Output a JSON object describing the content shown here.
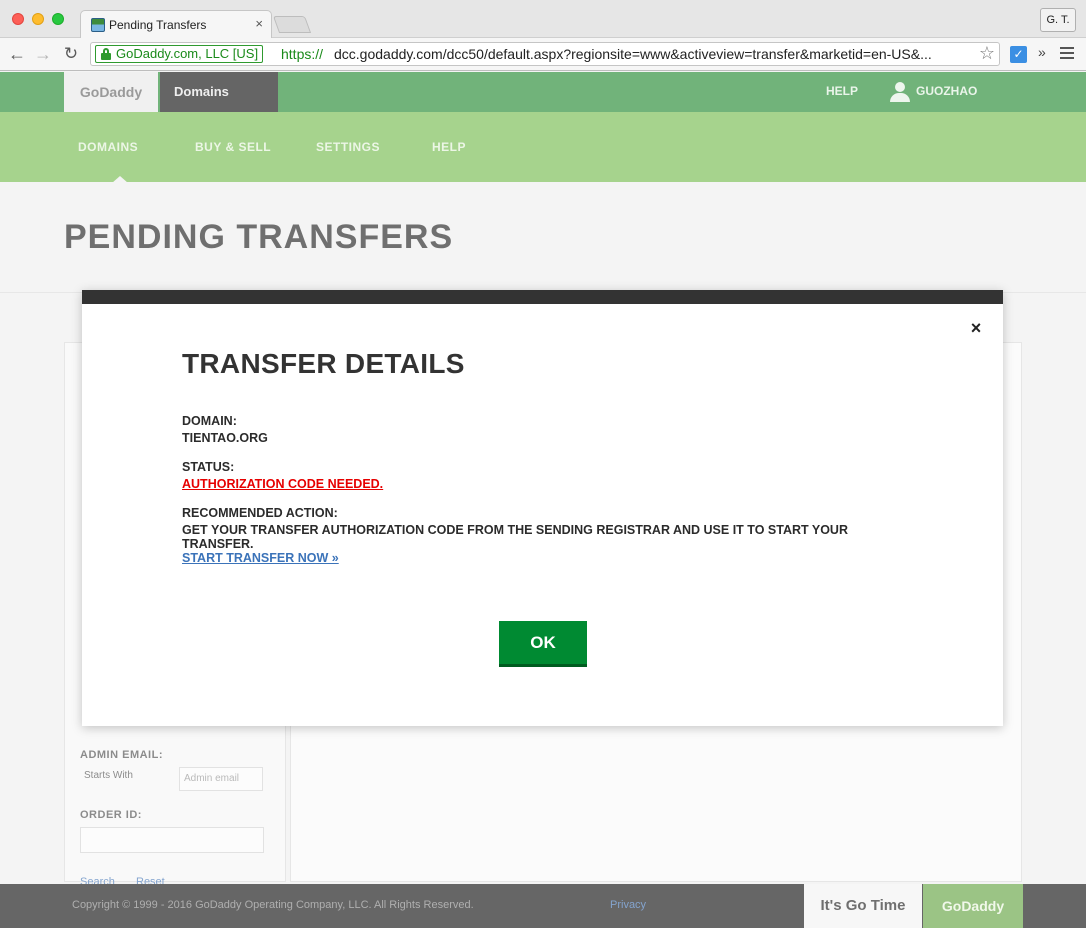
{
  "browser": {
    "tab_title": "Pending Transfers",
    "user_badge": "G. T.",
    "ev_label": "GoDaddy.com, LLC [US]",
    "url_scheme": "https://",
    "url_rest": "dcc.godaddy.com/dcc50/default.aspx?regionsite=www&activeview=transfer&marketid=en-US&..."
  },
  "site": {
    "logo": "GoDaddy",
    "product_switcher": "Domains",
    "help": "HELP",
    "username": "GUOZHAO",
    "nav": [
      "DOMAINS",
      "BUY & SELL",
      "SETTINGS",
      "HELP"
    ],
    "page_title": "PENDING TRANSFERS"
  },
  "filters": {
    "admin_email_label": "ADMIN EMAIL:",
    "admin_email_mode": "Starts With",
    "admin_email_placeholder": "Admin email",
    "order_id_label": "ORDER ID:",
    "search_link": "Search",
    "reset_link": "Reset"
  },
  "footer": {
    "copyright": "Copyright © 1999 - 2016 GoDaddy Operating Company, LLC. All Rights Reserved.",
    "privacy": "Privacy",
    "tagline": "It's Go Time",
    "logo": "GoDaddy"
  },
  "modal": {
    "title": "TRANSFER DETAILS",
    "domain_label": "DOMAIN:",
    "domain_value": "TIENTAO.ORG",
    "status_label": "STATUS:",
    "status_value": "AUTHORIZATION CODE NEEDED.",
    "action_label": "RECOMMENDED ACTION:",
    "action_text": "GET YOUR TRANSFER AUTHORIZATION CODE FROM THE SENDING REGISTRAR AND USE IT TO START YOUR TRANSFER.",
    "action_link": "START TRANSFER NOW »",
    "ok_button": "OK",
    "close_symbol": "×"
  },
  "colors": {
    "status_red": "#e60000",
    "ok_green": "#008a32",
    "link_blue": "#3b73b9",
    "header_green": "#7cbf58"
  }
}
